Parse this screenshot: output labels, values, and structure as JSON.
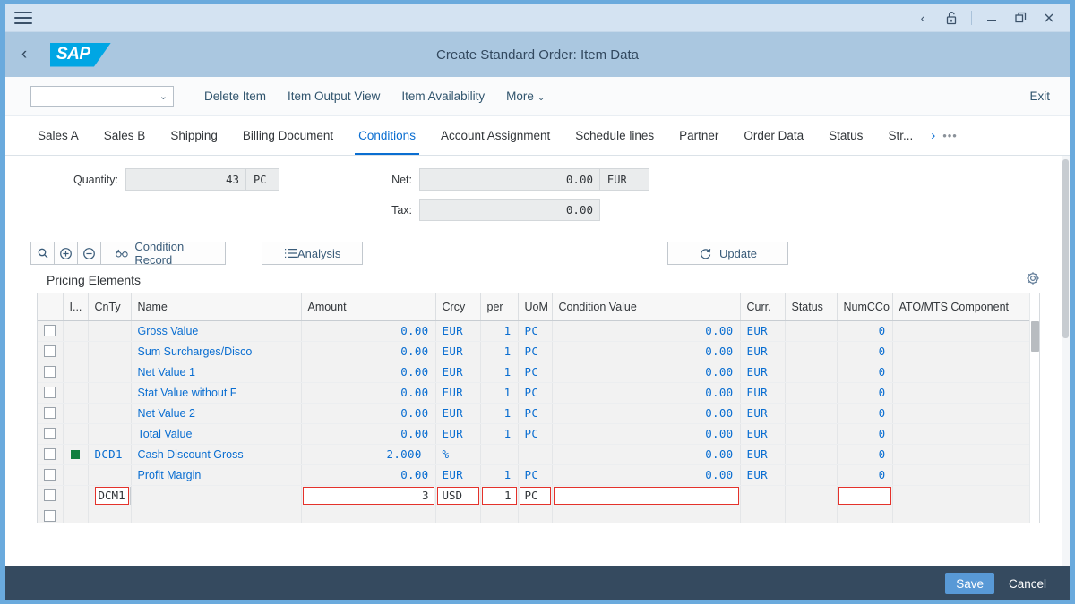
{
  "window": {
    "menu_icon": "hamburger-icon",
    "controls": [
      {
        "name": "history-back-icon",
        "glyph": "‹"
      },
      {
        "name": "unlock-icon",
        "glyph": "lock"
      },
      {
        "name": "minimize-icon",
        "glyph": "—"
      },
      {
        "name": "restore-icon",
        "glyph": "restore"
      },
      {
        "name": "close-icon",
        "glyph": "✕"
      }
    ]
  },
  "shell": {
    "back_label": "‹",
    "logo_text": "SAP",
    "title": "Create Standard Order: Item Data"
  },
  "toolbar": {
    "select_value": "",
    "select_caret": "⌄",
    "actions": [
      {
        "label": "Delete Item",
        "name": "delete-item-button"
      },
      {
        "label": "Item Output View",
        "name": "item-output-view-button"
      },
      {
        "label": "Item Availability",
        "name": "item-availability-button"
      }
    ],
    "more_label": "More",
    "more_caret": "⌄",
    "exit_label": "Exit"
  },
  "tabs": {
    "items": [
      {
        "label": "Sales A",
        "active": false
      },
      {
        "label": "Sales B",
        "active": false
      },
      {
        "label": "Shipping",
        "active": false
      },
      {
        "label": "Billing Document",
        "active": false
      },
      {
        "label": "Conditions",
        "active": true
      },
      {
        "label": "Account Assignment",
        "active": false
      },
      {
        "label": "Schedule lines",
        "active": false
      },
      {
        "label": "Partner",
        "active": false
      },
      {
        "label": "Order Data",
        "active": false
      },
      {
        "label": "Status",
        "active": false
      },
      {
        "label": "Str...",
        "active": false
      }
    ],
    "next_arrow": "›",
    "overflow": "•••"
  },
  "fields": {
    "quantity_label": "Quantity:",
    "quantity_value": "43",
    "quantity_unit": "PC",
    "net_label": "Net:",
    "net_value": "0.00",
    "net_unit": "EUR",
    "tax_label": "Tax:",
    "tax_value": "0.00"
  },
  "table_toolbar": {
    "search_icon": "magnifier-icon",
    "add_icon": "plus-circle-icon",
    "remove_icon": "minus-circle-icon",
    "condition_record_label": "Condition Record",
    "condition_record_icon": "glasses-icon",
    "analysis_label": "Analysis",
    "analysis_icon": "list-icon",
    "update_label": "Update",
    "update_icon": "refresh-icon"
  },
  "section": {
    "title": "Pricing Elements",
    "settings_icon": "gear-icon"
  },
  "grid": {
    "columns": [
      {
        "key": "check",
        "label": ""
      },
      {
        "key": "indicator",
        "label": "I..."
      },
      {
        "key": "cnty",
        "label": "CnTy"
      },
      {
        "key": "name",
        "label": "Name"
      },
      {
        "key": "amount",
        "label": "Amount"
      },
      {
        "key": "crcy",
        "label": "Crcy"
      },
      {
        "key": "per",
        "label": "per"
      },
      {
        "key": "uom",
        "label": "UoM"
      },
      {
        "key": "condition_value",
        "label": "Condition Value"
      },
      {
        "key": "curr",
        "label": "Curr."
      },
      {
        "key": "status",
        "label": "Status"
      },
      {
        "key": "numcco",
        "label": "NumCCo"
      },
      {
        "key": "ato_mts",
        "label": "ATO/MTS Component"
      }
    ],
    "rows": [
      {
        "indicator": "",
        "cnty": "",
        "name": "Gross Value",
        "amount": "0.00",
        "crcy": "EUR",
        "per": "1",
        "uom": "PC",
        "condition_value": "0.00",
        "curr": "EUR",
        "status": "",
        "numcco": "0",
        "ato_mts": "",
        "link": true,
        "editing": false
      },
      {
        "indicator": "",
        "cnty": "",
        "name": "Sum Surcharges/Disco",
        "amount": "0.00",
        "crcy": "EUR",
        "per": "1",
        "uom": "PC",
        "condition_value": "0.00",
        "curr": "EUR",
        "status": "",
        "numcco": "0",
        "ato_mts": "",
        "link": true,
        "editing": false
      },
      {
        "indicator": "",
        "cnty": "",
        "name": "Net Value 1",
        "amount": "0.00",
        "crcy": "EUR",
        "per": "1",
        "uom": "PC",
        "condition_value": "0.00",
        "curr": "EUR",
        "status": "",
        "numcco": "0",
        "ato_mts": "",
        "link": true,
        "editing": false
      },
      {
        "indicator": "",
        "cnty": "",
        "name": "Stat.Value without F",
        "amount": "0.00",
        "crcy": "EUR",
        "per": "1",
        "uom": "PC",
        "condition_value": "0.00",
        "curr": "EUR",
        "status": "",
        "numcco": "0",
        "ato_mts": "",
        "link": true,
        "editing": false
      },
      {
        "indicator": "",
        "cnty": "",
        "name": "Net Value 2",
        "amount": "0.00",
        "crcy": "EUR",
        "per": "1",
        "uom": "PC",
        "condition_value": "0.00",
        "curr": "EUR",
        "status": "",
        "numcco": "0",
        "ato_mts": "",
        "link": true,
        "editing": false
      },
      {
        "indicator": "",
        "cnty": "",
        "name": "Total Value",
        "amount": "0.00",
        "crcy": "EUR",
        "per": "1",
        "uom": "PC",
        "condition_value": "0.00",
        "curr": "EUR",
        "status": "",
        "numcco": "0",
        "ato_mts": "",
        "link": true,
        "editing": false
      },
      {
        "indicator": "green",
        "cnty": "DCD1",
        "name": "Cash Discount Gross",
        "amount": "2.000-",
        "crcy": "%",
        "per": "",
        "uom": "",
        "condition_value": "0.00",
        "curr": "EUR",
        "status": "",
        "numcco": "0",
        "ato_mts": "",
        "link": false,
        "editing": false
      },
      {
        "indicator": "",
        "cnty": "",
        "name": "Profit Margin",
        "amount": "0.00",
        "crcy": "EUR",
        "per": "1",
        "uom": "PC",
        "condition_value": "0.00",
        "curr": "EUR",
        "status": "",
        "numcco": "0",
        "ato_mts": "",
        "link": true,
        "editing": false
      },
      {
        "indicator": "",
        "cnty": "DCM1",
        "name": "",
        "amount": "3",
        "crcy": "USD",
        "per": "1",
        "uom": "PC",
        "condition_value": "",
        "curr": "",
        "status": "",
        "numcco": "",
        "ato_mts": "",
        "link": false,
        "editing": true
      },
      {
        "indicator": "",
        "cnty": "",
        "name": "",
        "amount": "",
        "crcy": "",
        "per": "",
        "uom": "",
        "condition_value": "",
        "curr": "",
        "status": "",
        "numcco": "",
        "ato_mts": "",
        "link": false,
        "editing": false
      }
    ]
  },
  "footer": {
    "save_label": "Save",
    "cancel_label": "Cancel"
  },
  "colors": {
    "accent": "#0a6ed1",
    "error": "#e4322b",
    "status_green": "#107e3e",
    "footer_bg": "#354a5f",
    "sap_blue": "#00a6e4"
  }
}
